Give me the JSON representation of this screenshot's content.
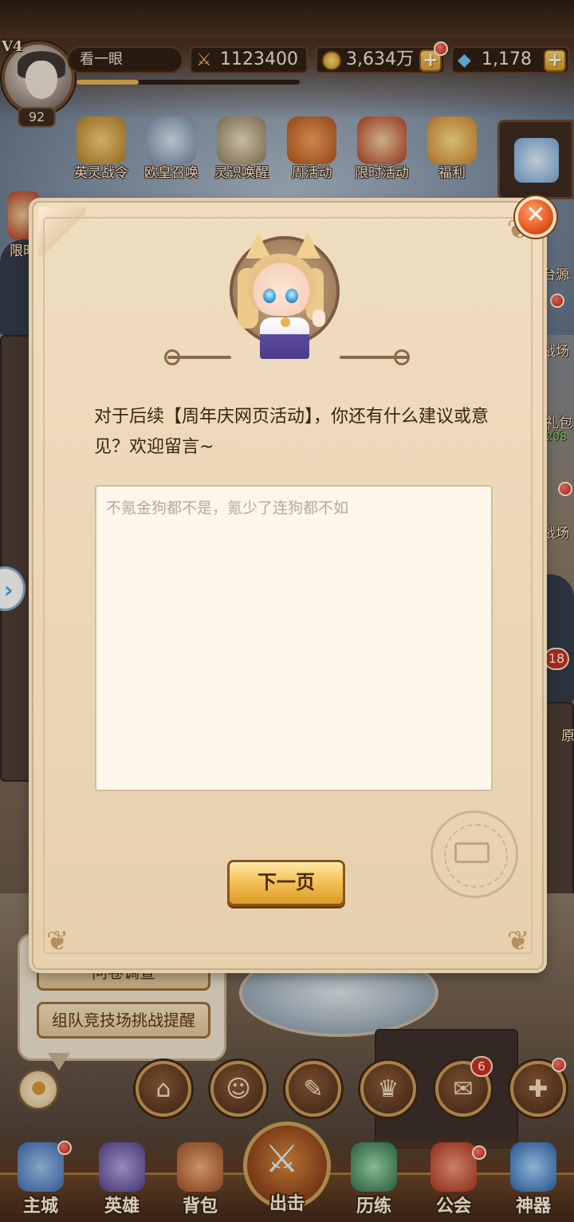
{
  "player": {
    "vip": "V4",
    "name": "看一眼",
    "level": "92",
    "xp_fraction": 0.28
  },
  "resources": {
    "combat_power": "1123400",
    "gold": "3,634万",
    "diamonds": "1,178"
  },
  "top_icons": [
    {
      "label": "英灵战令",
      "icon": "wings-emblem-icon",
      "color": "#d6a23e"
    },
    {
      "label": "欧皇召唤",
      "icon": "summon-hero-icon",
      "color": "#8aa4bf"
    },
    {
      "label": "灵识唤醒",
      "icon": "awaken-hero-icon",
      "color": "#c7b58e"
    },
    {
      "label": "周活动",
      "icon": "horn-icon",
      "color": "#d9742a"
    },
    {
      "label": "限时活动",
      "icon": "banner-icon",
      "color": "#c8402a"
    },
    {
      "label": "福利",
      "icon": "gift-chest-icon",
      "color": "#e4a339"
    }
  ],
  "side_fragments": {
    "left_partial": "限时",
    "right_items": [
      "台源",
      "战场",
      "礼包",
      "208",
      "战场",
      "原"
    ],
    "badge": "18"
  },
  "dialog": {
    "question": "对于后续【周年庆网页活动】，你还有什么建议或意见？欢迎留言~",
    "answer": "不氪金狗都不是，氪少了连狗都不如",
    "next_label": "下一页",
    "close_icon": "close-icon"
  },
  "reminders": {
    "partial_label": "问卷调查",
    "team_arena_label": "组队竞技场挑战提醒"
  },
  "round_buttons": [
    {
      "icon": "home-icon",
      "glyph": "⌂"
    },
    {
      "icon": "friends-icon",
      "glyph": "👥"
    },
    {
      "icon": "quest-scroll-icon",
      "glyph": "✎"
    },
    {
      "icon": "trophy-icon",
      "glyph": "🏆"
    },
    {
      "icon": "mail-icon",
      "glyph": "✉",
      "badge": "6"
    },
    {
      "icon": "plus-icon",
      "glyph": "✚"
    }
  ],
  "bottom_nav": [
    {
      "label": "主城",
      "icon": "castle-icon",
      "color": "#4a78c2"
    },
    {
      "label": "英雄",
      "icon": "helmet-icon",
      "color": "#6f5aa8"
    },
    {
      "label": "背包",
      "icon": "backpack-icon",
      "color": "#c26a3a"
    },
    {
      "label": "出击",
      "icon": "crossed-swords-icon",
      "color": "#d6873a"
    },
    {
      "label": "历练",
      "icon": "dragon-orb-icon",
      "color": "#3d8a5a"
    },
    {
      "label": "公会",
      "icon": "guild-flag-icon",
      "color": "#c8402a"
    },
    {
      "label": "神器",
      "icon": "artifact-orb-icon",
      "color": "#3f7fc4"
    }
  ],
  "colors": {
    "accent_gold": "#f4c35a",
    "parchment": "#ead6b6",
    "badge_red": "#c82c1e",
    "close_orange": "#e3571e"
  }
}
